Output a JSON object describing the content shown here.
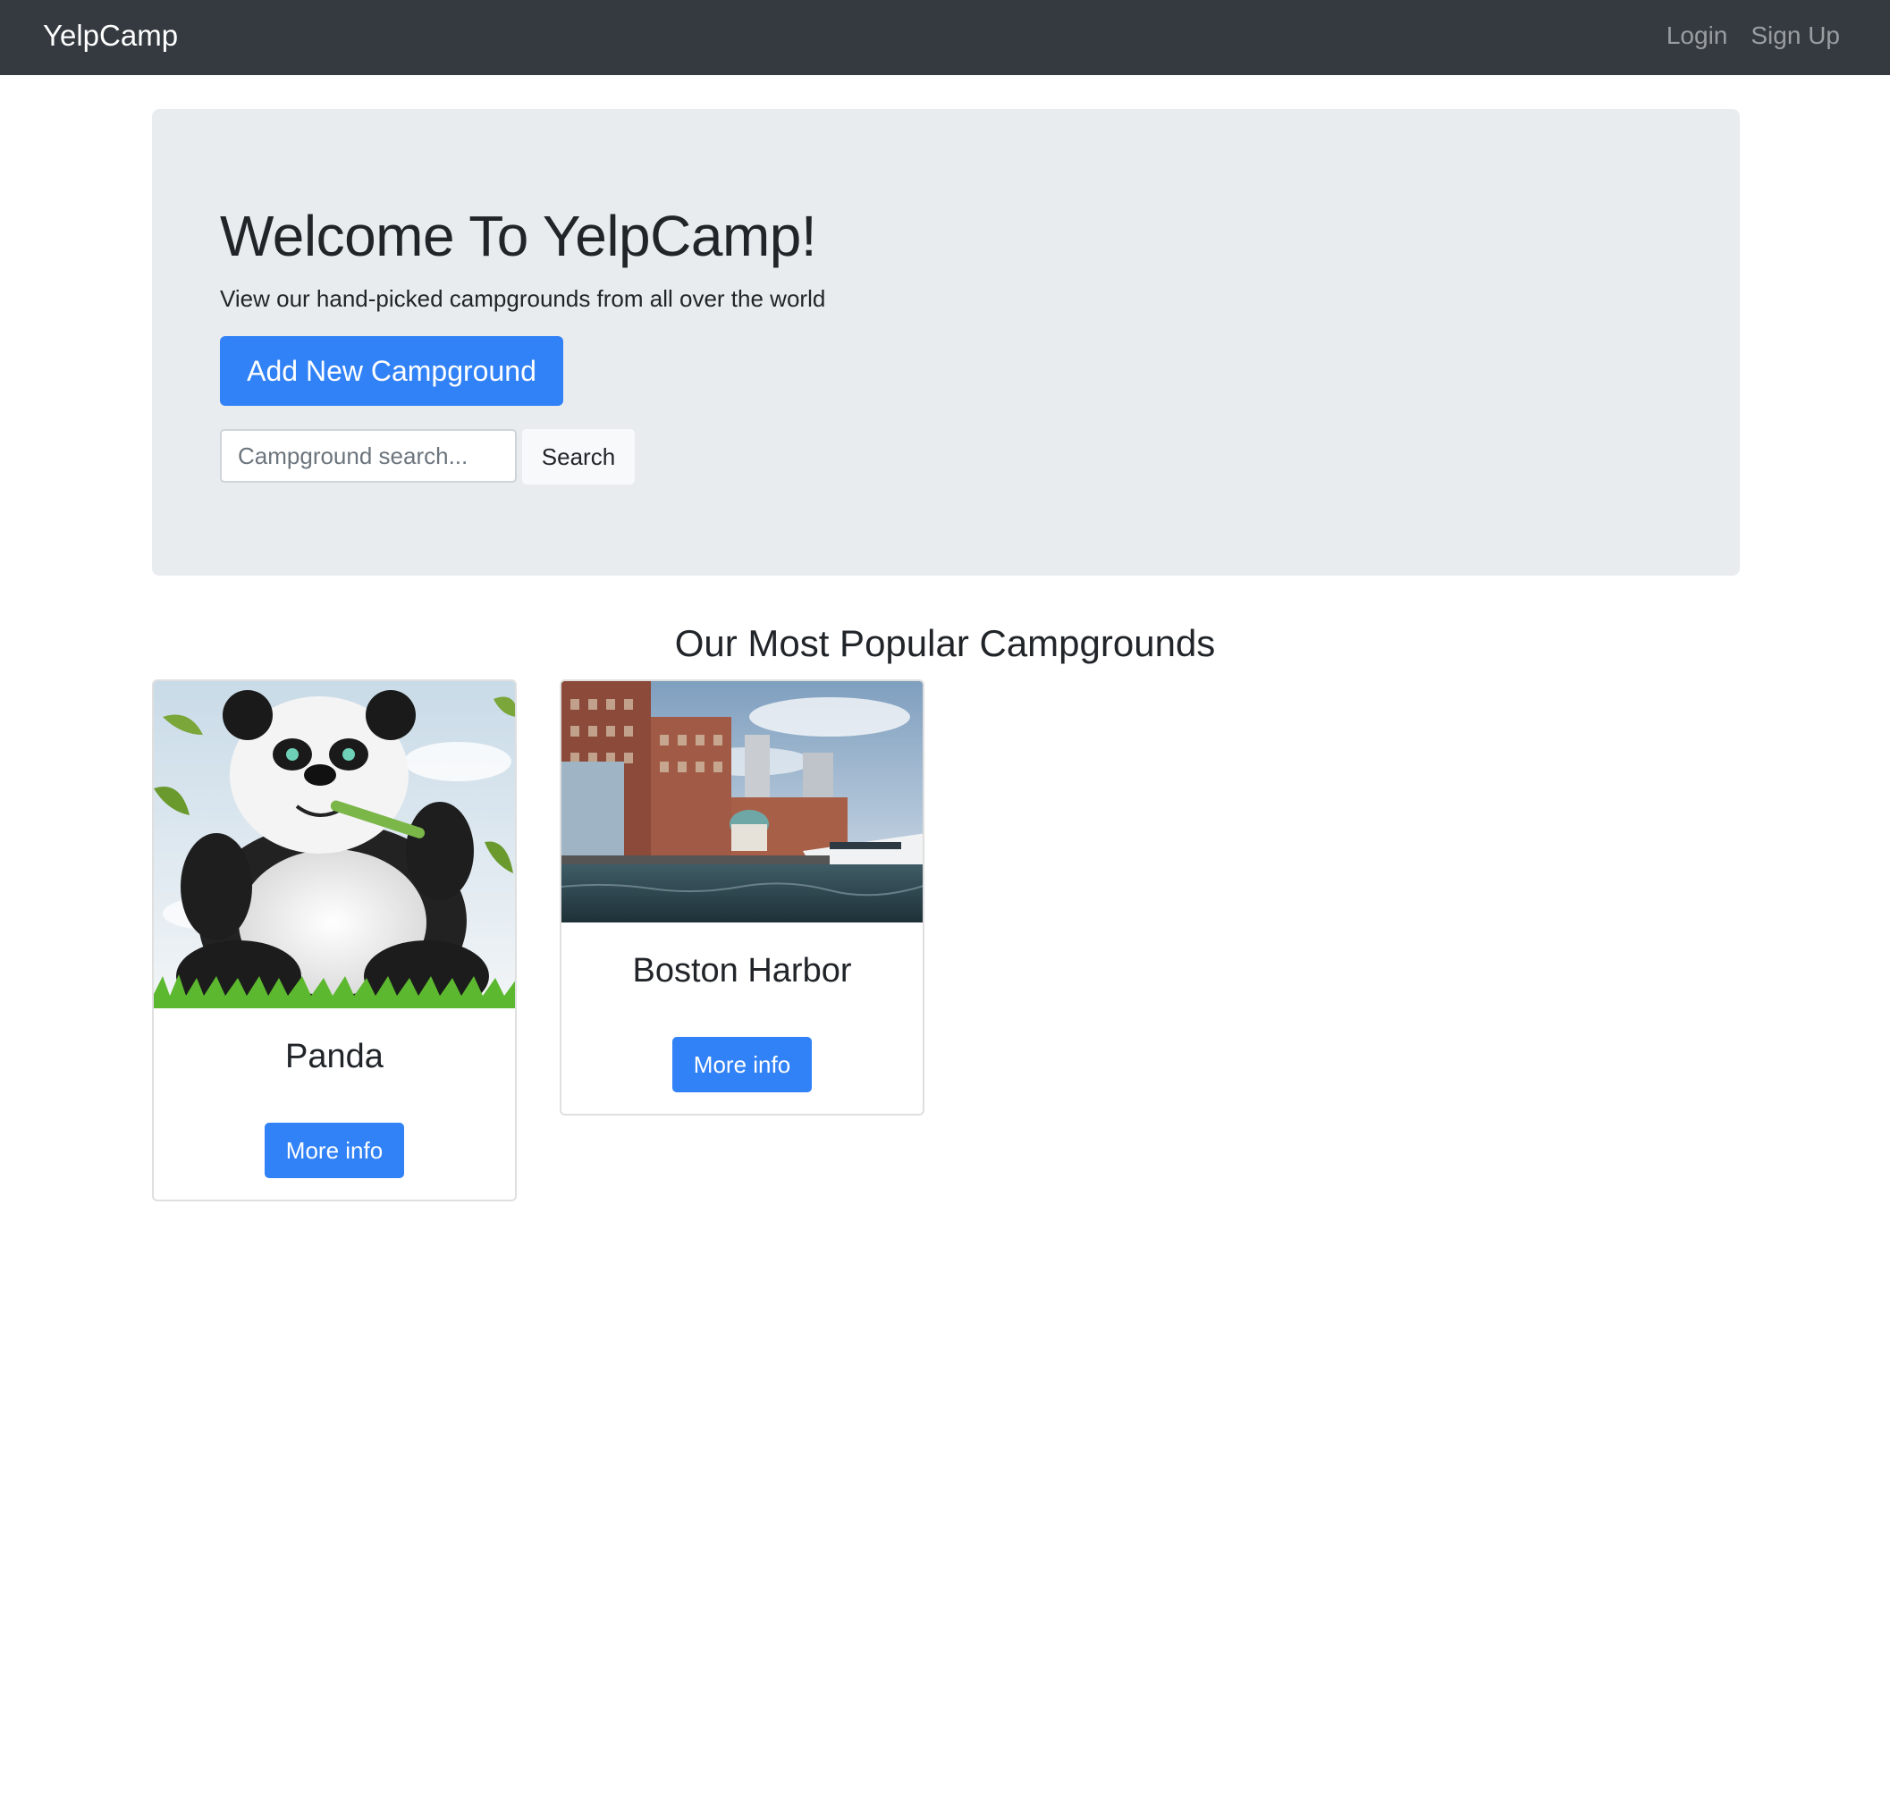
{
  "navbar": {
    "brand": "YelpCamp",
    "links": [
      {
        "label": "Login"
      },
      {
        "label": "Sign Up"
      }
    ],
    "background": "#343a40"
  },
  "jumbotron": {
    "title": "Welcome To YelpCamp!",
    "lead": "View our hand-picked campgrounds from all over the world",
    "add_button_label": "Add New Campground",
    "search": {
      "placeholder": "Campground search...",
      "value": "",
      "button_label": "Search"
    },
    "background": "#e9ecef"
  },
  "section": {
    "title": "Our Most Popular Campgrounds"
  },
  "campgrounds": [
    {
      "name": "Panda",
      "image": "panda-photo",
      "button_label": "More info"
    },
    {
      "name": "Boston Harbor",
      "image": "harbor-photo",
      "button_label": "More info"
    }
  ],
  "colors": {
    "primary": "#3182f6",
    "text": "#212529"
  }
}
